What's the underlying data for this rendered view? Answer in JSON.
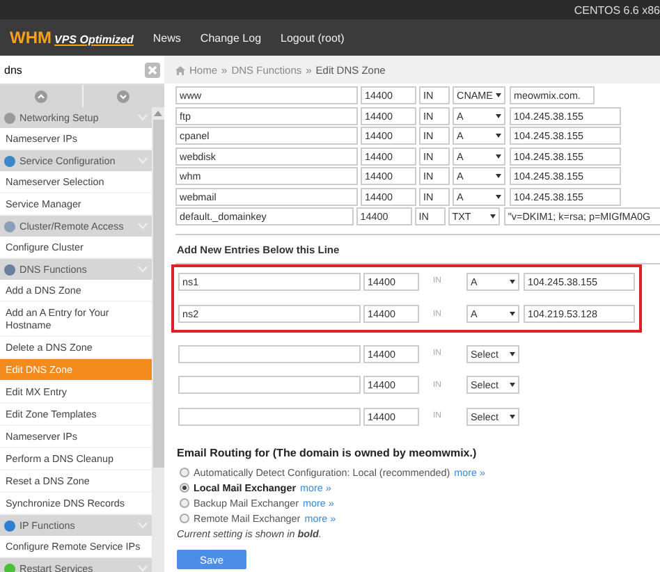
{
  "system_bar": {
    "text": "CENTOS 6.6 x86"
  },
  "header": {
    "logo": {
      "brand": "WHM",
      "tagline": "VPS Optimized"
    },
    "nav": [
      "News",
      "Change Log",
      "Logout (root)"
    ]
  },
  "sidebar": {
    "search": {
      "value": "dns"
    },
    "items": [
      {
        "label": "Networking Setup",
        "kind": "section",
        "color": "#9a9a9a",
        "selected": false
      },
      {
        "label": "Nameserver IPs",
        "kind": "link",
        "selected": false
      },
      {
        "label": "Service Configuration",
        "kind": "section",
        "color": "#3a86c8",
        "selected": false
      },
      {
        "label": "Nameserver Selection",
        "kind": "link",
        "selected": false
      },
      {
        "label": "Service Manager",
        "kind": "link",
        "selected": false
      },
      {
        "label": "Cluster/Remote Access",
        "kind": "section",
        "color": "#8aa0b8",
        "selected": false
      },
      {
        "label": "Configure Cluster",
        "kind": "link",
        "selected": false
      },
      {
        "label": "DNS Functions",
        "kind": "section",
        "color": "#6a7f9a",
        "selected": false
      },
      {
        "label": "Add a DNS Zone",
        "kind": "link",
        "selected": false
      },
      {
        "label": "Add an A Entry for Your Hostname",
        "kind": "link",
        "selected": false
      },
      {
        "label": "Delete a DNS Zone",
        "kind": "link",
        "selected": false
      },
      {
        "label": "Edit DNS Zone",
        "kind": "link",
        "selected": true
      },
      {
        "label": "Edit MX Entry",
        "kind": "link",
        "selected": false
      },
      {
        "label": "Edit Zone Templates",
        "kind": "link",
        "selected": false
      },
      {
        "label": "Nameserver IPs",
        "kind": "link",
        "selected": false
      },
      {
        "label": "Perform a DNS Cleanup",
        "kind": "link",
        "selected": false
      },
      {
        "label": "Reset a DNS Zone",
        "kind": "link",
        "selected": false
      },
      {
        "label": "Synchronize DNS Records",
        "kind": "link",
        "selected": false
      },
      {
        "label": "IP Functions",
        "kind": "section",
        "color": "#2f7fd0",
        "selected": false
      },
      {
        "label": "Configure Remote Service IPs",
        "kind": "link",
        "selected": false
      },
      {
        "label": "Restart Services",
        "kind": "section",
        "color": "#4cbf3a",
        "selected": false
      }
    ]
  },
  "breadcrumb": [
    "Home",
    "»",
    "DNS Functions",
    "»",
    "Edit DNS Zone"
  ],
  "records": [
    {
      "name": "www",
      "ttl": "14400",
      "class": "IN",
      "type": "CNAME",
      "value": "meowmix.com."
    },
    {
      "name": "ftp",
      "ttl": "14400",
      "class": "IN",
      "type": "A",
      "value": "104.245.38.155"
    },
    {
      "name": "cpanel",
      "ttl": "14400",
      "class": "IN",
      "type": "A",
      "value": "104.245.38.155"
    },
    {
      "name": "webdisk",
      "ttl": "14400",
      "class": "IN",
      "type": "A",
      "value": "104.245.38.155"
    },
    {
      "name": "whm",
      "ttl": "14400",
      "class": "IN",
      "type": "A",
      "value": "104.245.38.155"
    },
    {
      "name": "webmail",
      "ttl": "14400",
      "class": "IN",
      "type": "A",
      "value": "104.245.38.155"
    },
    {
      "name": "default._domainkey",
      "ttl": "14400",
      "class": "IN",
      "type": "TXT",
      "value": "\"v=DKIM1; k=rsa; p=MIGfMA0G"
    }
  ],
  "new_entries_heading": "Add New Entries Below this Line",
  "new_entries": [
    {
      "name": "ns1",
      "ttl": "14400",
      "class": "IN",
      "type": "A",
      "value": "104.245.38.155",
      "highlighted": true
    },
    {
      "name": "ns2",
      "ttl": "14400",
      "class": "IN",
      "type": "A",
      "value": "104.219.53.128",
      "highlighted": true
    },
    {
      "ttl": "14400",
      "class": "IN",
      "type": "Select",
      "highlighted": false
    },
    {
      "ttl": "14400",
      "class": "IN",
      "type": "Select",
      "highlighted": false
    },
    {
      "ttl": "14400",
      "class": "IN",
      "type": "Select",
      "highlighted": false
    }
  ],
  "email_routing": {
    "heading": "Email Routing for (The domain is owned by meomwmix.)",
    "options": [
      {
        "label": "Automatically Detect Configuration: Local (recommended)",
        "link": "more »",
        "selected": false
      },
      {
        "label": "Local Mail Exchanger",
        "link": "more »",
        "selected": true
      },
      {
        "label": "Backup Mail Exchanger",
        "link": "more »",
        "selected": false
      },
      {
        "label": "Remote Mail Exchanger",
        "link": "more »",
        "selected": false
      }
    ],
    "note": "Current setting is shown in **bold**.",
    "button": "Save"
  }
}
